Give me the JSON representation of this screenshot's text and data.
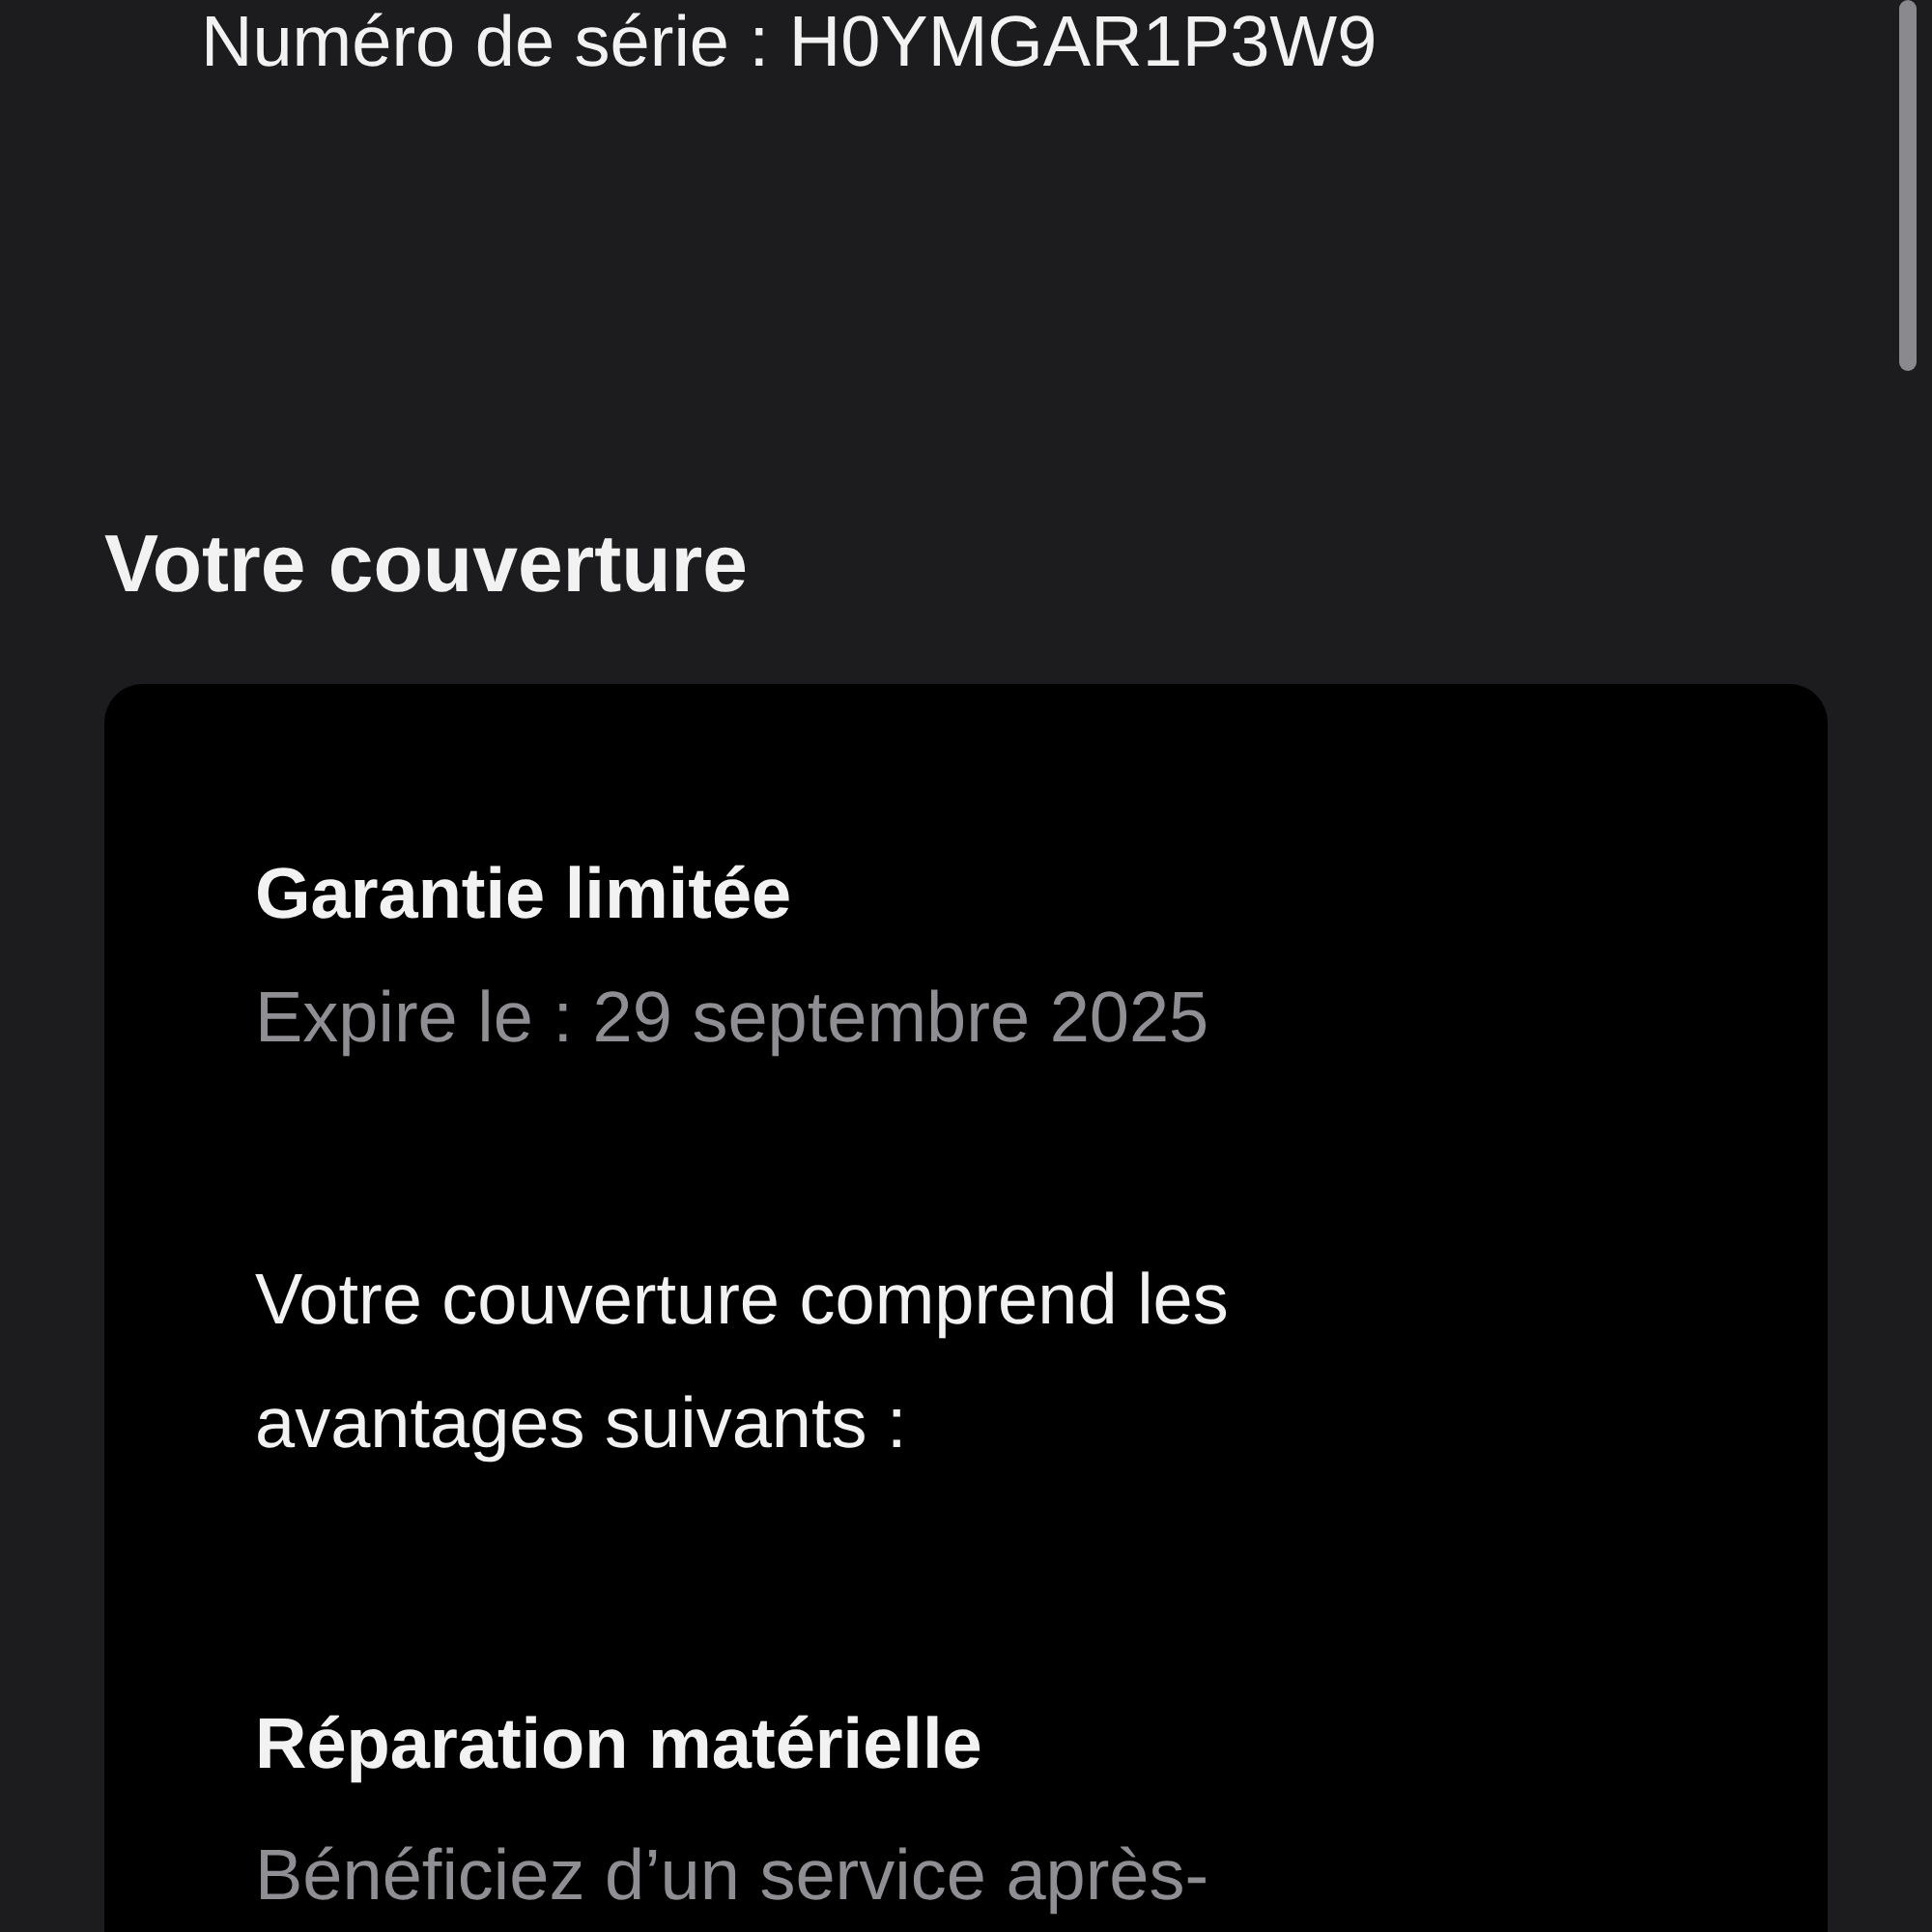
{
  "serial": {
    "text": "Numéro de série : H0YMGAR1P3W9"
  },
  "section_title": "Votre couverture",
  "coverage_card": {
    "plan_title": "Garantie limitée",
    "expiry": "Expire le : 29 septembre 2025",
    "description": "Votre couverture comprend les avantages suivants :",
    "benefits": [
      {
        "title": "Réparation matérielle",
        "description": "Bénéficiez d’un service après-"
      }
    ]
  }
}
